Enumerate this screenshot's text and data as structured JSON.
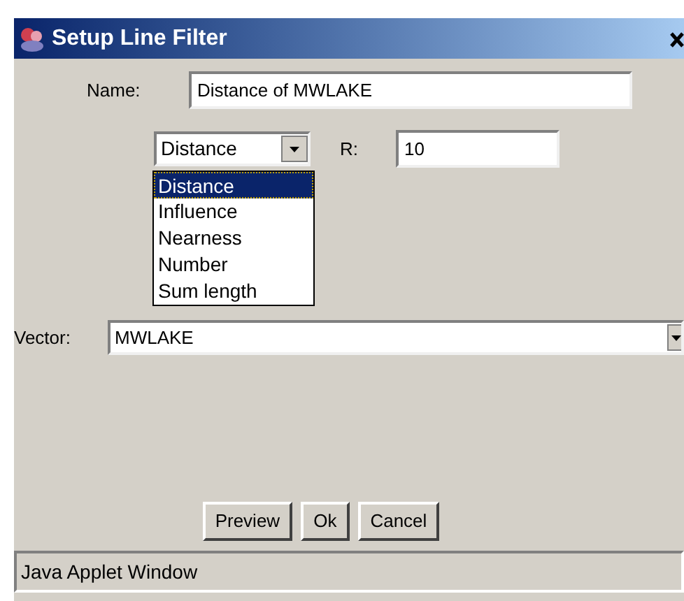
{
  "window": {
    "title": "Setup Line Filter"
  },
  "name": {
    "label": "Name:",
    "value": "Distance of MWLAKE"
  },
  "measure": {
    "value": "Distance",
    "expanded": true,
    "options": [
      {
        "label": "Distance",
        "selected": true
      },
      {
        "label": "Influence",
        "selected": false
      },
      {
        "label": "Nearness",
        "selected": false
      },
      {
        "label": "Number",
        "selected": false
      },
      {
        "label": "Sum length",
        "selected": false
      }
    ]
  },
  "r": {
    "label": "R:",
    "value": "10"
  },
  "vector": {
    "label": "Vector:",
    "value": "MWLAKE"
  },
  "buttons": [
    "Preview",
    "Ok",
    "Cancel"
  ],
  "status_bar": "Java Applet Window"
}
